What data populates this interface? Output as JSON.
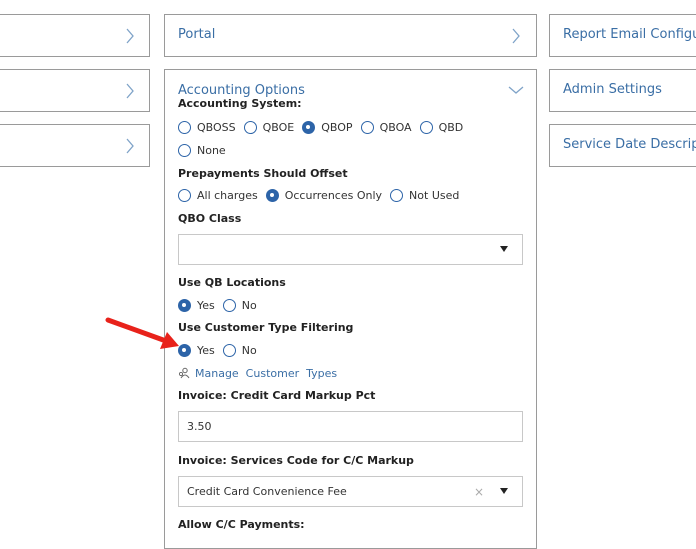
{
  "left_column": {
    "panels": [
      {
        "title": "",
        "state": "collapsed"
      },
      {
        "title": "",
        "state": "collapsed"
      },
      {
        "title": "",
        "state": "collapsed"
      }
    ]
  },
  "middle_column": {
    "portal_panel": {
      "title": "Portal"
    },
    "accounting_panel": {
      "title": "Accounting Options",
      "accounting_system": {
        "label": "Accounting System:",
        "options": [
          "QBOSS",
          "QBOE",
          "QBOP",
          "QBOA",
          "QBD",
          "None"
        ],
        "selected": "QBOP"
      },
      "prepayments": {
        "label": "Prepayments Should Offset",
        "options": [
          "All charges",
          "Occurrences Only",
          "Not Used"
        ],
        "selected": "Occurrences Only"
      },
      "qbo_class": {
        "label": "QBO Class",
        "value": ""
      },
      "qb_locations": {
        "label": "Use QB Locations",
        "options": [
          "Yes",
          "No"
        ],
        "selected": "Yes"
      },
      "customer_type_filtering": {
        "label": "Use Customer Type Filtering",
        "options": [
          "Yes",
          "No"
        ],
        "selected": "Yes"
      },
      "manage_link": {
        "label": "Manage  Customer  Types"
      },
      "cc_markup_pct": {
        "label": "Invoice: Credit Card Markup Pct",
        "value": "3.50"
      },
      "cc_services_code": {
        "label": "Invoice: Services Code for C/C Markup",
        "value": "Credit Card Convenience Fee",
        "clear_symbol": "×"
      },
      "allow_cc_payments": {
        "label": "Allow C/C Payments:"
      }
    }
  },
  "right_column": {
    "panels": [
      {
        "title": "Report Email Configur"
      },
      {
        "title": "Admin Settings"
      },
      {
        "title": "Service Date Descriptio"
      }
    ]
  },
  "colors": {
    "accent": "#2d64a8",
    "link": "#3a6ea5",
    "border": "#9a9a9a",
    "arrow": "#e8221b"
  },
  "icons": {
    "collapsed": "chevron-right-icon",
    "expanded": "chevron-down-icon",
    "manage": "users-icon",
    "dropdown": "caret-down-icon",
    "annotation": "red-arrow-icon"
  }
}
